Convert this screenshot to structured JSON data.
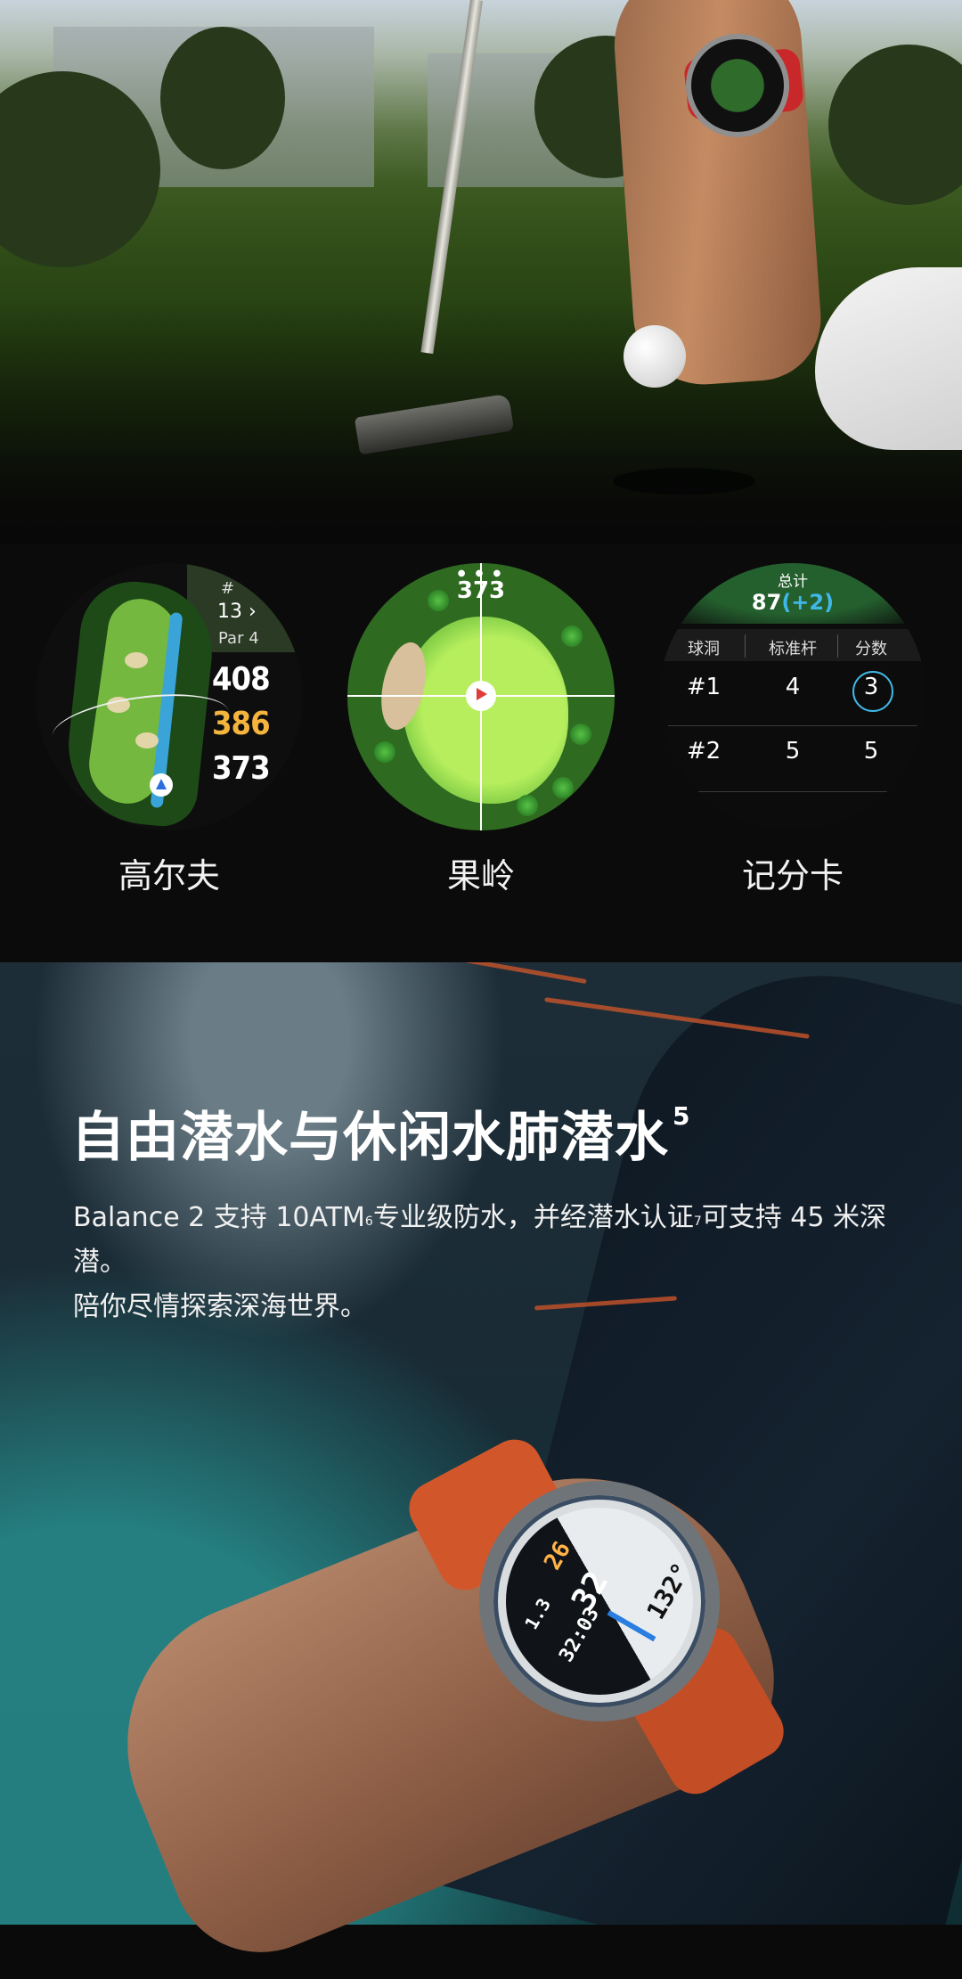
{
  "golf": {
    "hole_map": {
      "hash": "#",
      "hole_number": "13",
      "chevron": "›",
      "par": "Par 4",
      "distance_back": "408",
      "distance_middle": "386",
      "distance_front": "373",
      "caption": "高尔夫"
    },
    "green_view": {
      "distance": "373",
      "caption": "果岭"
    },
    "scorecard": {
      "total_label": "总计",
      "total_score": "87",
      "total_delta": "(+2)",
      "headers": [
        "球洞",
        "标准杆",
        "分数"
      ],
      "rows": [
        {
          "hole": "#1",
          "par": "4",
          "score": "3"
        },
        {
          "hole": "#2",
          "par": "5",
          "score": "5"
        }
      ],
      "caption": "记分卡"
    }
  },
  "dive": {
    "title": "自由潜水与休闲水肺潜水",
    "title_sup": "5",
    "desc_part1": "Balance 2 支持 10ATM",
    "desc_sup1": "6",
    "desc_part2": "专业级防水，并经潜水认证",
    "desc_sup2": "7",
    "desc_part3": "可支持 45 米深潜。",
    "desc_line2": "陪你尽情探索深海世界。",
    "watch": {
      "time": "32:03",
      "depth": "32",
      "depth_unit": "m",
      "ndl": "26",
      "ascent": "1.3",
      "heading": "132°"
    }
  },
  "colors": {
    "accent_blue": "#3fb8e8",
    "distance_orange": "#f5b53d",
    "strap_orange": "#d1572b"
  }
}
